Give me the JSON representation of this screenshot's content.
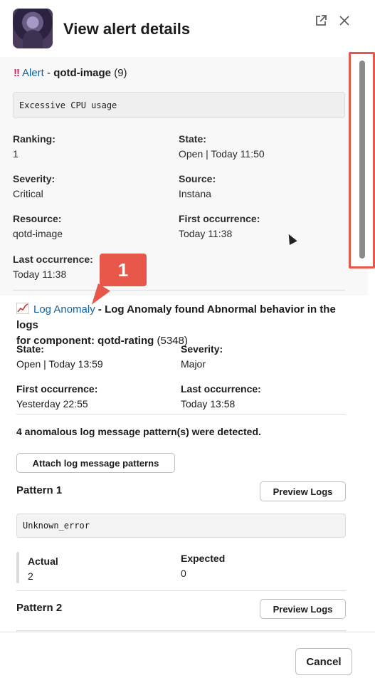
{
  "header": {
    "title": "View alert details",
    "external_icon": "external-link-icon",
    "close_icon": "close-icon"
  },
  "alert": {
    "marker": "!!",
    "link_text": "Alert",
    "separator": " - ",
    "name": "qotd-image",
    "count": "(9)",
    "summary": "Excessive CPU usage",
    "fields": {
      "ranking_label": "Ranking:",
      "ranking_value": "1",
      "state_label": "State:",
      "state_value": "Open | Today 11:50",
      "severity_label": "Severity:",
      "severity_value": "Critical",
      "source_label": "Source:",
      "source_value": "Instana",
      "resource_label": "Resource:",
      "resource_value": "qotd-image",
      "first_label": "First occurrence:",
      "first_value": "Today 11:38",
      "last_label": "Last occurrence:",
      "last_value": "Today 11:38"
    }
  },
  "callout": {
    "number": "1"
  },
  "anomaly": {
    "icon": "line-chart-icon",
    "link_text": "Log Anomaly",
    "desc_line1": " - Log Anomaly found Abnormal behavior in the logs",
    "desc_line2": "for component: qotd-rating",
    "count": "(5348)",
    "state_label": "State:",
    "state_value": "Open | Today 13:59",
    "severity_label": "Severity:",
    "severity_value": "Major",
    "first_label": "First occurrence:",
    "first_value": "Yesterday 22:55",
    "last_label": "Last occurrence:",
    "last_value": "Today 13:58",
    "patterns_summary": "4 anomalous log message pattern(s) were detected.",
    "attach_button": "Attach log message patterns"
  },
  "patterns": [
    {
      "title": "Pattern 1",
      "preview_button": "Preview Logs",
      "message": "Unknown_error",
      "actual_label": "Actual",
      "actual_value": "2",
      "expected_label": "Expected",
      "expected_value": "0"
    },
    {
      "title": "Pattern 2",
      "preview_button": "Preview Logs"
    }
  ],
  "footer": {
    "cancel_button": "Cancel"
  },
  "colors": {
    "link": "#1264a3",
    "highlight": "#e8584a",
    "alert_marker": "#e01e5a"
  }
}
